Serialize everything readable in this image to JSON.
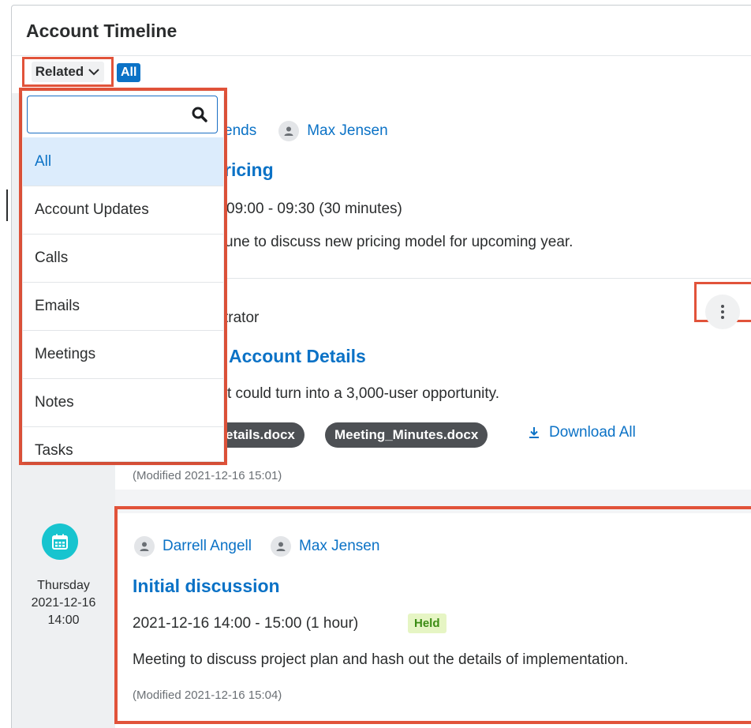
{
  "header": {
    "title": "Account Timeline"
  },
  "filter": {
    "related_label": "Related",
    "all_label": "All"
  },
  "dropdown": {
    "search_value": "",
    "items": [
      "All",
      "Account Updates",
      "Calls",
      "Emails",
      "Meetings",
      "Notes",
      "Tasks"
    ]
  },
  "entry1": {
    "person_partial": "ends",
    "person2": "Max Jensen",
    "title_partial": "ricing",
    "time_partial": "09:00 - 09:30 (30 minutes)",
    "desc_partial": "une to discuss new pricing model for upcoming year."
  },
  "entry2": {
    "author_partial": "trator",
    "title_partial": "Account Details",
    "desc_partial": "t could turn into a 3,000-user opportunity.",
    "attachment1_partial": "etails.docx",
    "attachment2": "Meeting_Minutes.docx",
    "download_all": "Download All",
    "modified": "(Modified 2021-12-16 15:01)"
  },
  "entry3": {
    "day": "Thursday",
    "date": "2021-12-16",
    "time": "14:00",
    "person1": "Darrell Angell",
    "person2": "Max Jensen",
    "title": "Initial discussion",
    "time_range": "2021-12-16 14:00 - 15:00 (1 hour)",
    "status": "Held",
    "description": "Meeting to discuss project plan and hash out the details of implementation.",
    "modified": "(Modified 2021-12-16 15:04)"
  },
  "icons": {
    "chevron": "chevron-down-icon",
    "search": "search-icon",
    "person": "person-icon",
    "kebab": "kebab-menu-icon",
    "download": "download-icon",
    "calendar": "calendar-icon"
  },
  "colors": {
    "accent": "#0b72c6",
    "highlight": "#e1533a",
    "calendar": "#17c4cf",
    "held_bg": "#e6f5c4",
    "held_text": "#3c8c14"
  }
}
